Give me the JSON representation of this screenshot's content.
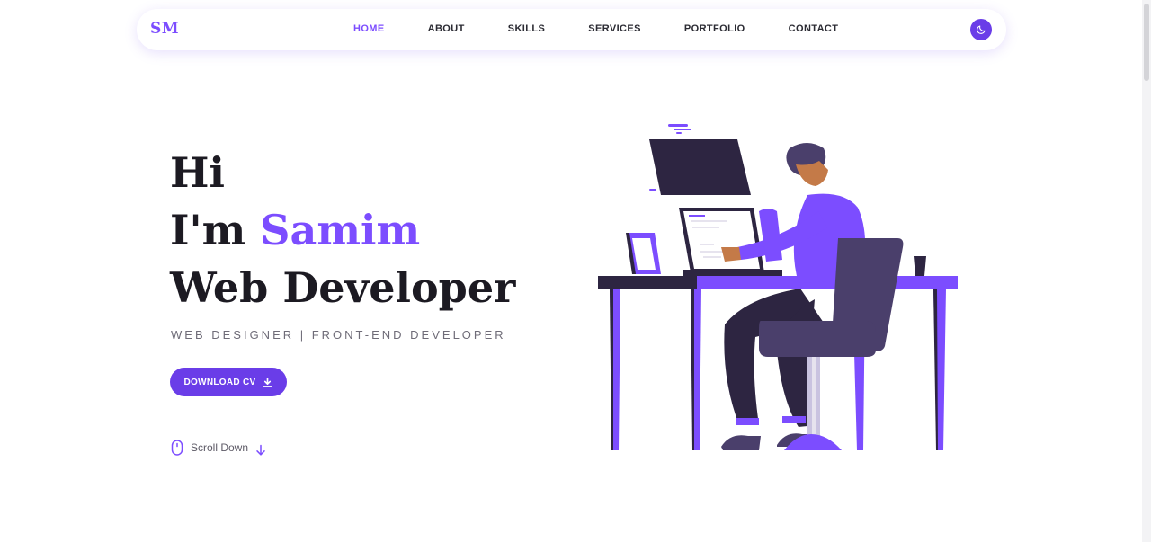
{
  "nav": {
    "logo": "SM",
    "links": [
      {
        "label": "HOME",
        "active": true
      },
      {
        "label": "ABOUT",
        "active": false
      },
      {
        "label": "SKILLS",
        "active": false
      },
      {
        "label": "SERVICES",
        "active": false
      },
      {
        "label": "PORTFOLIO",
        "active": false
      },
      {
        "label": "CONTACT",
        "active": false
      }
    ],
    "theme_toggle_icon": "moon-icon"
  },
  "hero": {
    "line1": "Hi",
    "line2_prefix": "I'm ",
    "name": "Samim",
    "line3": "Web Developer",
    "subtitle": "WEB DESIGNER | FRONT-END DEVELOPER",
    "download_button": "DOWNLOAD CV",
    "download_icon": "download-icon",
    "scroll_label": "Scroll Down",
    "scroll_icon": "mouse-icon",
    "scroll_arrow_icon": "arrow-down-icon"
  },
  "colors": {
    "accent": "#7c4dff",
    "accent_dark": "#6a3de8",
    "text": "#1c1a22",
    "illustration_dark": "#2d2541",
    "illustration_purple": "#7c4dff"
  }
}
